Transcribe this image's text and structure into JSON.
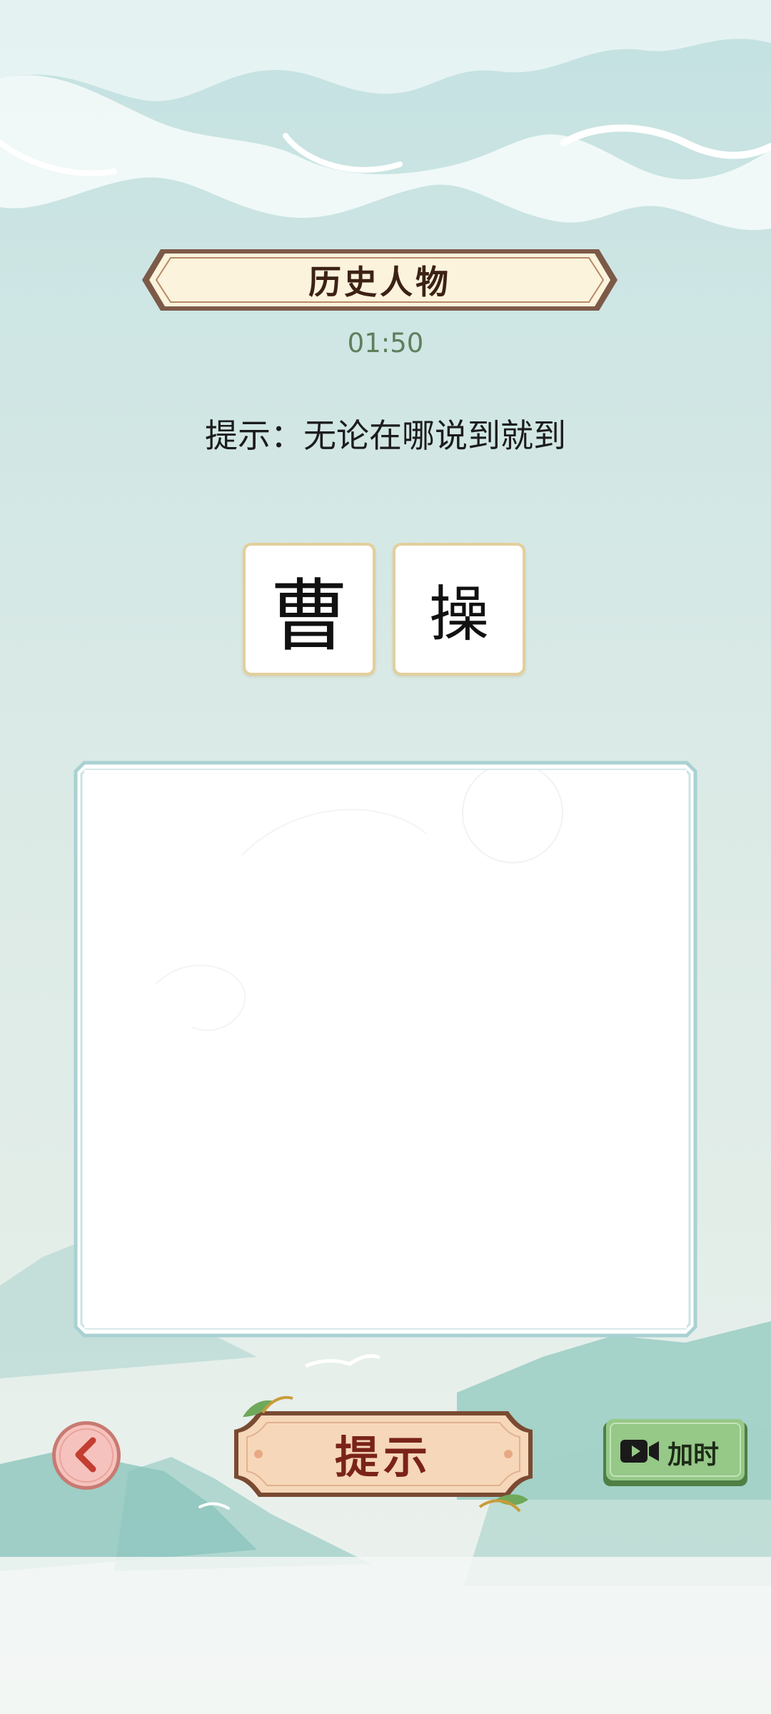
{
  "header": {
    "category": "历史人物",
    "timer": "01:50"
  },
  "hint": {
    "text": "提示：无论在哪说到就到"
  },
  "answer_tiles": [
    {
      "char": "曹"
    },
    {
      "char": "操"
    }
  ],
  "buttons": {
    "hint_label": "提示",
    "add_time_label": "加时"
  },
  "icons": {
    "back": "back-arrow-icon",
    "video": "video-camera-icon"
  },
  "colors": {
    "sky": "#c3e1e1",
    "banner_fill": "#fbf3dc",
    "banner_border": "#6b4a3a",
    "timer": "#5e7f5d",
    "tile_border": "#e3cf9c",
    "canvas_border": "#a9d1d2",
    "hint_button_fill": "#f6d7b9",
    "hint_button_text": "#7a2319",
    "add_time_fill": "#96c888",
    "back_button_fill": "#f6c2bd"
  }
}
